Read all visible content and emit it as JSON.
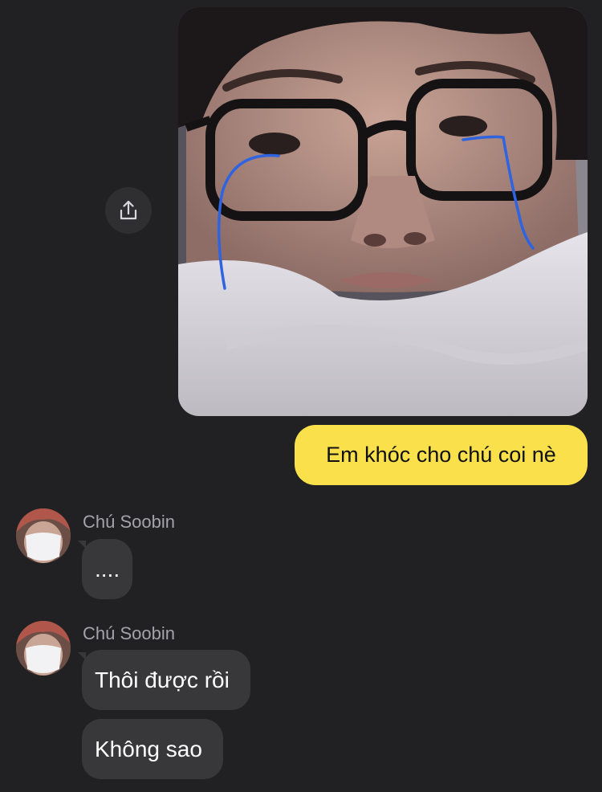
{
  "chat": {
    "photo_icon": "crying-selfie-photo",
    "share_icon": "share-icon",
    "outgoing_text": "Em khóc cho chú coi nè",
    "outgoing_color": "#fae04b",
    "incoming_color": "#38383b",
    "background_color": "#212123"
  },
  "group1": {
    "sender": "Chú Soobin",
    "avatar_icon": "masked-face-avatar",
    "message": "...."
  },
  "group2": {
    "sender": "Chú Soobin",
    "avatar_icon": "masked-face-avatar",
    "message1": "Thôi được rồi",
    "message2": "Không sao"
  }
}
